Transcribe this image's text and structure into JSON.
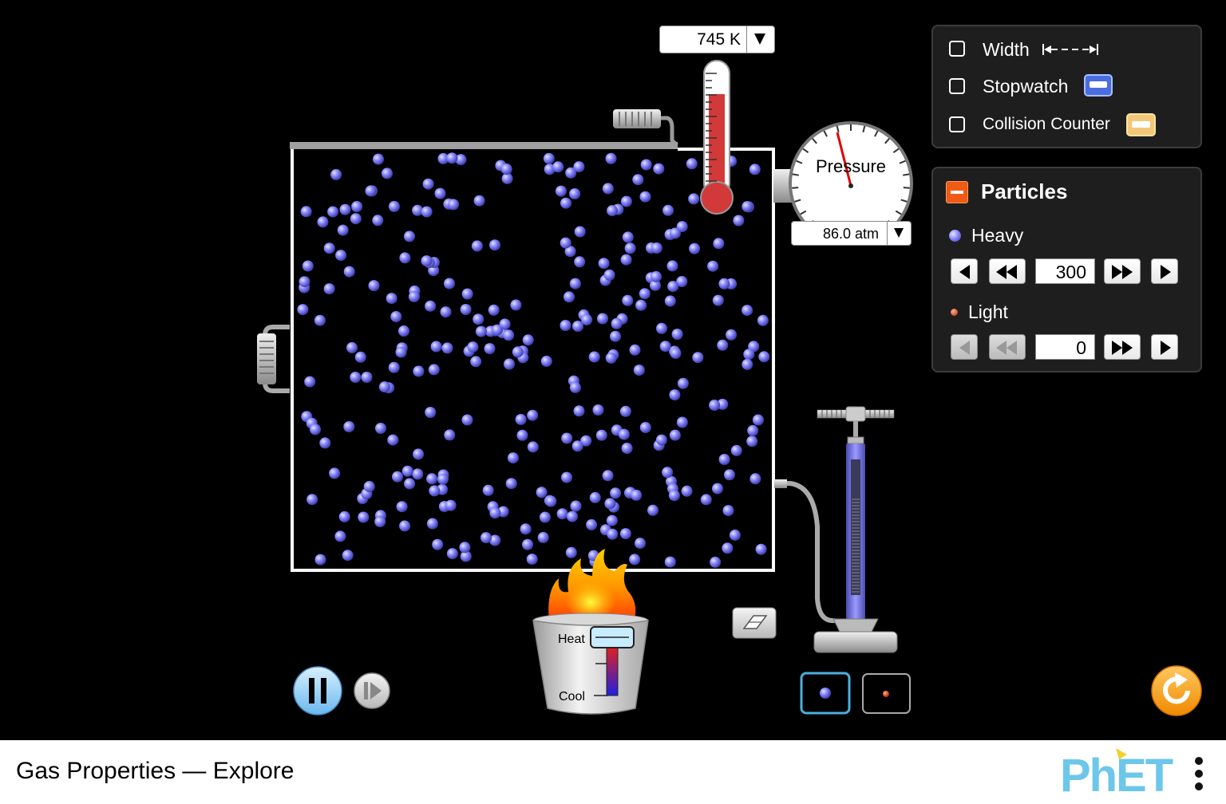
{
  "thermometer": {
    "value": "745 K"
  },
  "pressure_gauge": {
    "label": "Pressure",
    "value": "86.0 atm"
  },
  "tools_panel": {
    "width_label": "Width",
    "stopwatch_label": "Stopwatch",
    "collision_label": "Collision Counter"
  },
  "particles_panel": {
    "title": "Particles",
    "heavy_label": "Heavy",
    "heavy_count": "300",
    "light_label": "Light",
    "light_count": "0"
  },
  "heater": {
    "heat_label": "Heat",
    "cool_label": "Cool"
  },
  "footer": {
    "title": "Gas Properties — Explore"
  },
  "colors": {
    "heavy_particle": "#8080ff",
    "light_particle": "#e04020",
    "accent_orange": "#f5a023"
  },
  "icons": [
    "pause-icon",
    "step-forward-icon",
    "eraser-icon",
    "reset-icon",
    "menu-dots-icon",
    "stopwatch-icon",
    "collision-counter-icon"
  ]
}
